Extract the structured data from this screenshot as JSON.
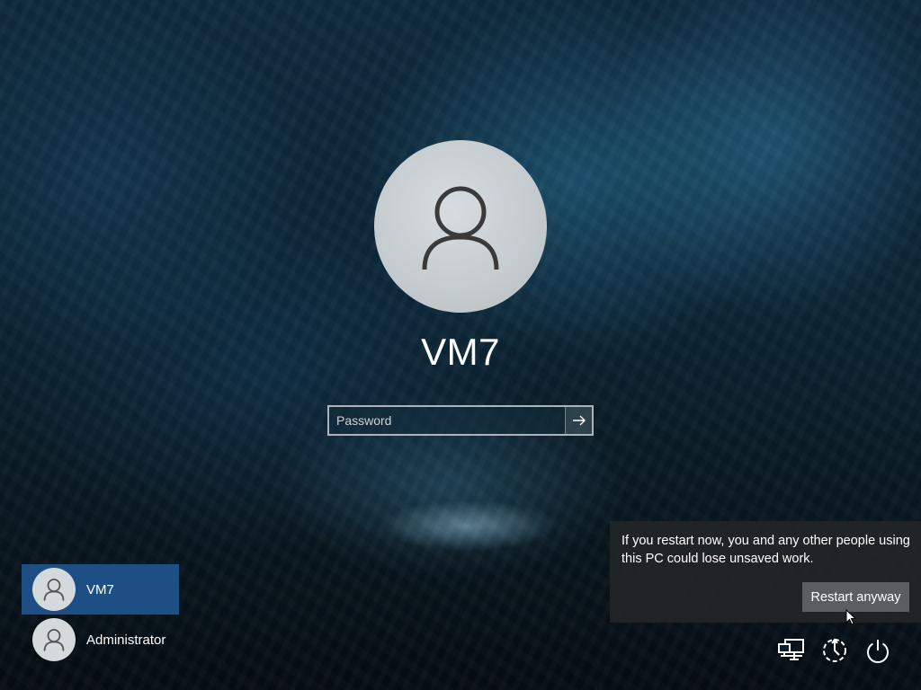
{
  "login": {
    "username": "VM7",
    "password_placeholder": "Password",
    "submit_icon": "arrow-right-icon"
  },
  "user_list": [
    {
      "name": "VM7",
      "selected": true
    },
    {
      "name": "Administrator",
      "selected": false
    }
  ],
  "restart_flyout": {
    "message": "If you restart now, you and any other people using this PC could lose unsaved work.",
    "button_label": "Restart anyway"
  },
  "corner_icons": [
    "network-icon",
    "ease-of-access-icon",
    "power-icon"
  ],
  "colors": {
    "selected_user_bg": "#1d4f85",
    "flyout_bg": "#202428",
    "button_bg": "#5a5e62"
  }
}
